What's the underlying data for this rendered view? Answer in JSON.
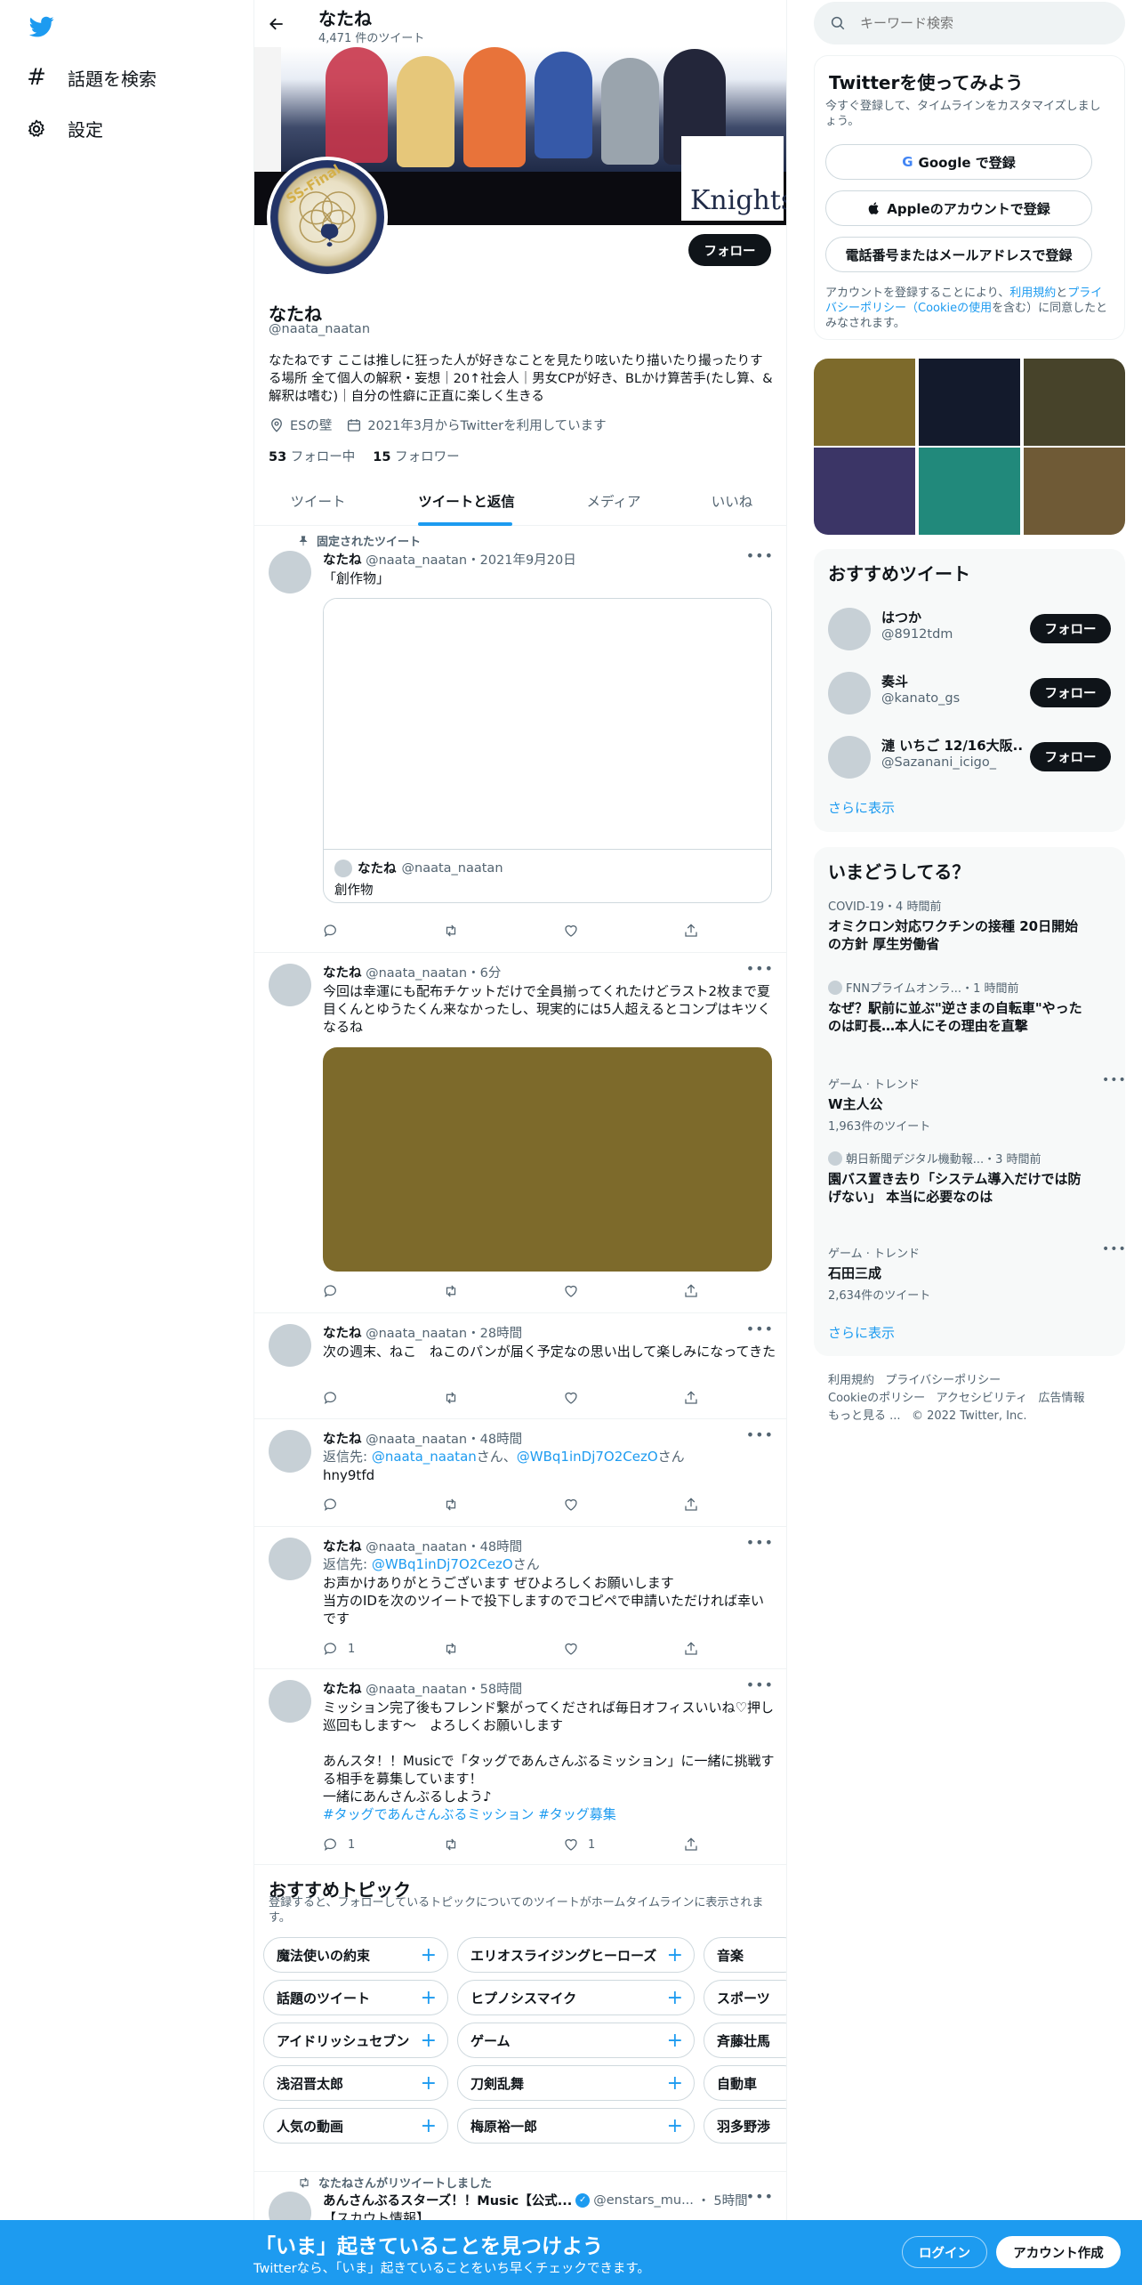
{
  "nav": {
    "explore": "話題を検索",
    "settings": "設定"
  },
  "header": {
    "name": "なたね",
    "tweet_count": "4,471 件のツイート"
  },
  "profile": {
    "name": "なたね",
    "handle": "@naata_naatan",
    "follow_label": "フォロー",
    "bio": "なたねです ここは推しに狂った人が好きなことを見たり呟いたり描いたり撮ったりする場所 全て個人の解釈・妄想｜20↑社会人｜男女CPが好き、BLかけ算苦手(たし算、&解釈は嗜む)｜自分の性癖に正直に楽しく生きる",
    "location": "ESの壁",
    "joined": "2021年3月からTwitterを利用しています",
    "following_count": "53",
    "following_label": "フォロー中",
    "followers_count": "15",
    "followers_label": "フォロワー",
    "banner_text": "Knights",
    "emblem_text": "SS-Final"
  },
  "tabs": [
    "ツイート",
    "ツイートと返信",
    "メディア",
    "いいね"
  ],
  "tweets": [
    {
      "pinned_label": "固定されたツイート",
      "name": "なたね",
      "handle": "@naata_naatan",
      "time": "2021年9月20日",
      "text": "「創作物」",
      "quote_name": "なたね",
      "quote_handle": "@naata_naatan",
      "quote_text": "創作物"
    },
    {
      "name": "なたね",
      "handle": "@naata_naatan",
      "time": "6分",
      "text": "今回は幸運にも配布チケットだけで全員揃ってくれたけどラスト2枚まで夏目くんとゆうたくん来なかったし、現実的には5人超えるとコンプはキツくなるね",
      "media_color": "#7d6a2b"
    },
    {
      "name": "なたね",
      "handle": "@naata_naatan",
      "time": "28時間",
      "text": "次の週末、ねこ　ねこのパンが届く予定なの思い出して楽しみになってきた"
    },
    {
      "name": "なたね",
      "handle": "@naata_naatan",
      "time": "48時間",
      "reply_prefix": "返信先: ",
      "reply_to_1": "@naata_naatan",
      "reply_sep": "さん、",
      "reply_to_2": "@WBq1inDj7O2CezO",
      "reply_suffix": "さん",
      "text": "hny9tfd"
    },
    {
      "name": "なたね",
      "handle": "@naata_naatan",
      "time": "48時間",
      "reply_prefix": "返信先: ",
      "reply_to_1": "@WBq1inDj7O2CezO",
      "reply_suffix": "さん",
      "text": "お声かけありがとうございます ぜひよろしくお願いします\n当方のIDを次のツイートで投下しますのでコピペで申請いただければ幸いです",
      "reply_count": "1"
    },
    {
      "name": "なたね",
      "handle": "@naata_naatan",
      "time": "58時間",
      "text": "ミッション完了後もフレンド繋がってくだされば毎日オフィスいいね♡押し巡回もします〜　よろしくお願いします\n\nあんスタ！！Musicで「タッグであんさんぶるミッション」に一緒に挑戦する相手を募集しています！\n一緒にあんさんぶるしよう♪",
      "hashtags": "#タッグであんさんぶるミッション #タッグ募集",
      "reply_count": "1",
      "like_count": "1"
    }
  ],
  "topics": {
    "title": "おすすめトピック",
    "subtitle": "登録すると、フォローしているトピックについてのツイートがホームタイムラインに表示されます。",
    "rows": [
      [
        "魔法使いの約束",
        "エリオスライジングヒーローズ",
        "音楽"
      ],
      [
        "話題のツイート",
        "ヒプノシスマイク",
        "スポーツ"
      ],
      [
        "アイドリッシュセブン",
        "ゲーム",
        "斉藤壮馬"
      ],
      [
        "浅沼晋太郎",
        "刀剣乱舞",
        "自動車"
      ],
      [
        "人気の動画",
        "梅原裕一郎",
        "羽多野渉"
      ]
    ]
  },
  "retweet": {
    "label": "なたねさんがリツイートしました",
    "name": "あんさんぶるスターズ！！Music【公式...",
    "handle": "@enstars_mu...",
    "time": "5時間",
    "text": "【スカウト情報】"
  },
  "search": {
    "placeholder": "キーワード検索"
  },
  "signup": {
    "title": "Twitterを使ってみよう",
    "subtitle": "今すぐ登録して、タイムラインをカスタマイズしましょう。",
    "google": "Google で登録",
    "apple": "Appleのアカウントで登録",
    "phone": "電話番号またはメールアドレスで登録",
    "terms_1": "アカウントを登録することにより、",
    "terms_link_1": "利用規約",
    "terms_2": "と",
    "terms_link_2": "プライバシーポリシー（Cookieの使用",
    "terms_3": "を含む）に同意したとみなされます。"
  },
  "media_grid": [
    "#7d6a2b",
    "#131a2c",
    "#47432a",
    "#3b3566",
    "#21897b",
    "#6f5a36"
  ],
  "recommended": {
    "title": "おすすめツイート",
    "users": [
      {
        "name": "はつか",
        "handle": "@8912tdm",
        "button": "フォロー"
      },
      {
        "name": "奏斗",
        "handle": "@kanato_gs",
        "button": "フォロー"
      },
      {
        "name": "漣 いちご 12/16大阪...",
        "handle": "@Sazanani_icigo_",
        "button": "フォロー"
      }
    ],
    "more": "さらに表示"
  },
  "trends": {
    "title": "いまどうしてる？",
    "items": [
      {
        "meta": "COVID-19・4 時間前",
        "title": "オミクロン対応ワクチンの接種 20日開始の方針 厚生労働省"
      },
      {
        "meta": "FNNプライムオンラ...・1 時間前",
        "title": "なぜ？駅前に並ぶ\"逆さまの自転車\"やったのは町長…本人にその理由を直撃"
      },
      {
        "meta": "ゲーム · トレンド",
        "title": "W主人公",
        "count": "1,963件のツイート"
      },
      {
        "meta": "朝日新聞デジタル機動報...・3 時間前",
        "title": "園バス置き去り「システム導入だけでは防げない」 本当に必要なのは"
      },
      {
        "meta": "ゲーム · トレンド",
        "title": "石田三成",
        "count": "2,634件のツイート"
      }
    ],
    "more": "さらに表示"
  },
  "footer": {
    "links": [
      "利用規約",
      "プライバシーポリシー",
      "Cookieのポリシー",
      "アクセシビリティ",
      "広告情報",
      "もっと見る ..."
    ],
    "copyright": "© 2022 Twitter, Inc."
  },
  "bottom_bar": {
    "title": "「いま」起きていることを見つけよう",
    "subtitle": "Twitterなら、「いま」起きていることをいち早くチェックできます。",
    "login": "ログイン",
    "signup": "アカウント作成"
  },
  "colors": {
    "brand": "#1d9bf0",
    "text": "#0f1419",
    "muted": "#536471",
    "border": "#eff3f4"
  }
}
